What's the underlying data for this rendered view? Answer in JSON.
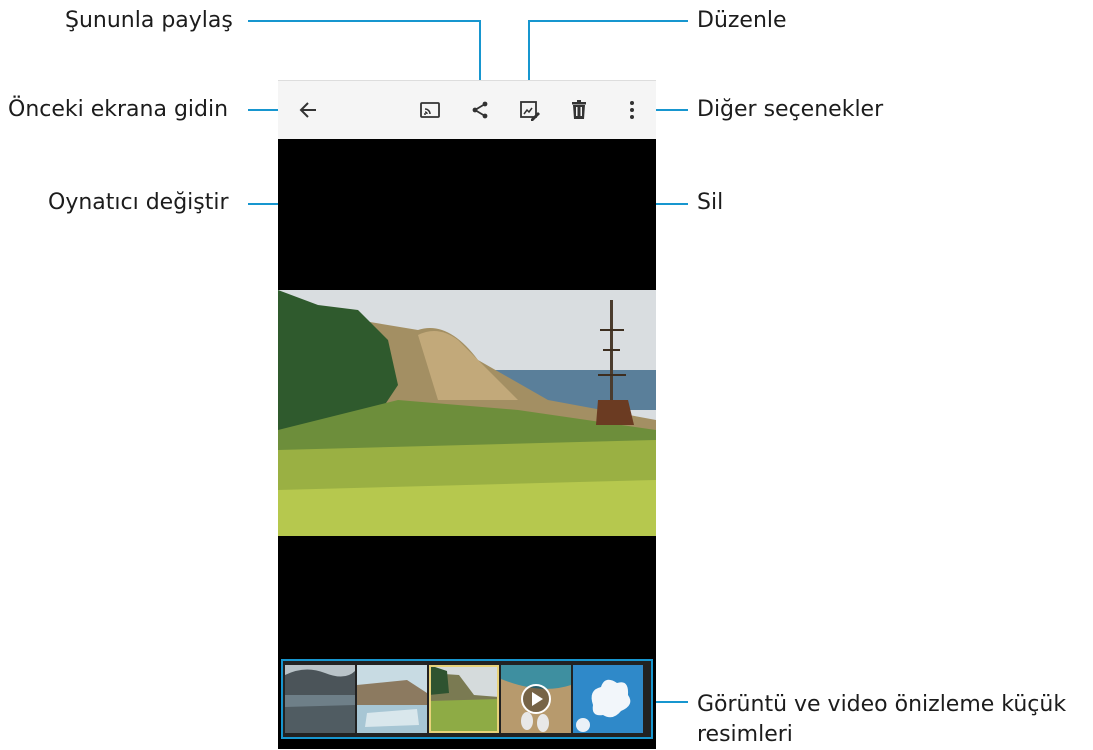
{
  "callouts": {
    "share": "Şununla paylaş",
    "edit": "Düzenle",
    "back": "Önceki ekrana gidin",
    "more": "Diğer seçenekler",
    "switch_player": "Oynatıcı değiştir",
    "delete": "Sil",
    "thumbnails": "Görüntü ve video önizleme küçük resimleri"
  },
  "toolbar": {
    "icons": [
      "back-arrow-icon",
      "switch-player-icon",
      "share-icon",
      "edit-icon",
      "delete-icon",
      "more-options-icon"
    ]
  },
  "colors": {
    "accent": "#1796cf",
    "toolbar_bg": "#f5f5f5",
    "viewer_bg": "#000000"
  },
  "thumbnails": [
    "seascape",
    "rocky-coast",
    "green-meadow",
    "video-feet-beach",
    "cloud-sky"
  ]
}
